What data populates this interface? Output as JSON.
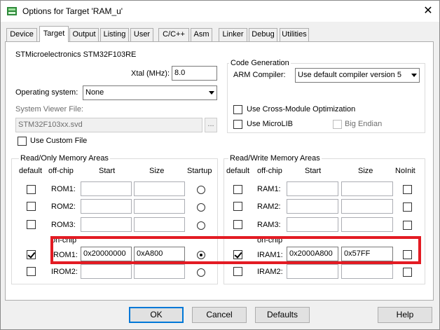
{
  "window": {
    "title": "Options for Target 'RAM_u'"
  },
  "tabs": [
    "Device",
    "Target",
    "Output",
    "Listing",
    "User",
    "C/C++",
    "Asm",
    "Linker",
    "Debug",
    "Utilities"
  ],
  "target": {
    "device_name": "STMicroelectronics STM32F103RE",
    "xtal_label": "Xtal (MHz):",
    "xtal_value": "8.0",
    "os_label": "Operating system:",
    "os_value": "None",
    "svd_label": "System Viewer File:",
    "svd_value": "STM32F103xx.svd",
    "browse_label": "...",
    "use_custom_file": "Use Custom File"
  },
  "codegen": {
    "title": "Code Generation",
    "compiler_label": "ARM Compiler:",
    "compiler_value": "Use default compiler version 5",
    "cross_module": "Use Cross-Module Optimization",
    "microlib": "Use MicroLIB",
    "big_endian": "Big Endian"
  },
  "ro_memory": {
    "title": "Read/Only Memory Areas",
    "headers": {
      "default": "default",
      "offchip": "off-chip",
      "start": "Start",
      "size": "Size",
      "startup": "Startup"
    },
    "onchip_label": "on-chip",
    "rows": [
      {
        "label": "ROM1:",
        "start": "",
        "size": ""
      },
      {
        "label": "ROM2:",
        "start": "",
        "size": ""
      },
      {
        "label": "ROM3:",
        "start": "",
        "size": ""
      },
      {
        "label": "IROM1:",
        "start": "0x20000000",
        "size": "0xA800"
      },
      {
        "label": "IROM2:",
        "start": "",
        "size": ""
      }
    ]
  },
  "rw_memory": {
    "title": "Read/Write Memory Areas",
    "headers": {
      "default": "default",
      "offchip": "off-chip",
      "start": "Start",
      "size": "Size",
      "noinit": "NoInit"
    },
    "onchip_label": "on-chip",
    "rows": [
      {
        "label": "RAM1:",
        "start": "",
        "size": ""
      },
      {
        "label": "RAM2:",
        "start": "",
        "size": ""
      },
      {
        "label": "RAM3:",
        "start": "",
        "size": ""
      },
      {
        "label": "IRAM1:",
        "start": "0x2000A800",
        "size": "0x57FF"
      },
      {
        "label": "IRAM2:",
        "start": "",
        "size": ""
      }
    ]
  },
  "buttons": {
    "ok": "OK",
    "cancel": "Cancel",
    "defaults": "Defaults",
    "help": "Help"
  },
  "colors": {
    "highlight": "#e31b23",
    "focus": "#0078d7"
  }
}
